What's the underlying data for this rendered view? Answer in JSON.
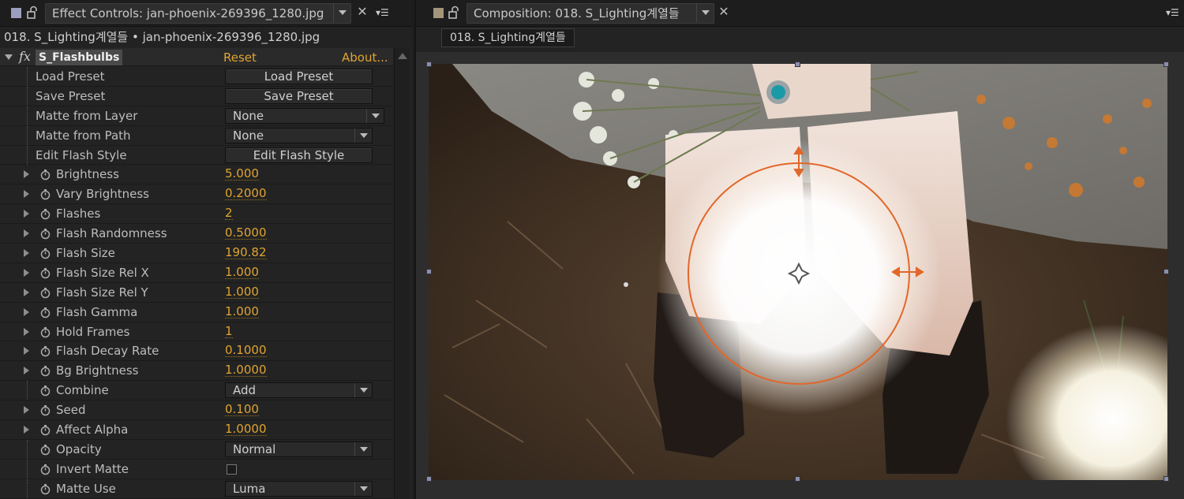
{
  "effect_panel": {
    "tab_title": "Effect Controls: jan-phoenix-269396_1280.jpg",
    "breadcrumb": "018. S_Lighting계열들 • jan-phoenix-269396_1280.jpg",
    "effect_name": "S_Flashbulbs",
    "reset_label": "Reset",
    "about_label": "About...",
    "fx_glyph": "fx",
    "rows": [
      {
        "label": "Load Preset",
        "kind": "button",
        "value": "Load Preset"
      },
      {
        "label": "Save Preset",
        "kind": "button",
        "value": "Save Preset"
      },
      {
        "label": "Matte from Layer",
        "kind": "select",
        "value": "None"
      },
      {
        "label": "Matte from Path",
        "kind": "select",
        "value": "None"
      },
      {
        "label": "Edit Flash Style",
        "kind": "button",
        "value": "Edit Flash Style"
      },
      {
        "label": "Brightness",
        "kind": "value",
        "value": "5.000"
      },
      {
        "label": "Vary Brightness",
        "kind": "value",
        "value": "0.2000"
      },
      {
        "label": "Flashes",
        "kind": "value",
        "value": "2"
      },
      {
        "label": "Flash Randomness",
        "kind": "value",
        "value": "0.5000"
      },
      {
        "label": "Flash Size",
        "kind": "value",
        "value": "190.82"
      },
      {
        "label": "Flash Size Rel X",
        "kind": "value",
        "value": "1.000"
      },
      {
        "label": "Flash Size Rel Y",
        "kind": "value",
        "value": "1.000"
      },
      {
        "label": "Flash Gamma",
        "kind": "value",
        "value": "1.000"
      },
      {
        "label": "Hold Frames",
        "kind": "value",
        "value": "1"
      },
      {
        "label": "Flash Decay Rate",
        "kind": "value",
        "value": "0.1000"
      },
      {
        "label": "Bg Brightness",
        "kind": "value",
        "value": "1.0000"
      },
      {
        "label": "Combine",
        "kind": "select",
        "value": "Add"
      },
      {
        "label": "Seed",
        "kind": "value",
        "value": "0.100"
      },
      {
        "label": "Affect Alpha",
        "kind": "value",
        "value": "1.0000"
      },
      {
        "label": "Opacity",
        "kind": "select",
        "value": "Normal"
      },
      {
        "label": "Invert Matte",
        "kind": "checkbox",
        "value": false
      },
      {
        "label": "Matte Use",
        "kind": "select",
        "value": "Luma"
      }
    ]
  },
  "composition_panel": {
    "tab_title": "Composition: 018. S_Lighting계열들",
    "comp_name": "018. S_Lighting계열들"
  },
  "colors": {
    "accent_value": "#e0a431",
    "gizmo": "#e2672a",
    "panel_bg": "#232323"
  },
  "icons": [
    "lock-icon",
    "stopwatch-icon",
    "close-icon",
    "panel-menu-icon",
    "twirl-icon",
    "position-crosshair-icon",
    "scale-arrow-icon"
  ]
}
